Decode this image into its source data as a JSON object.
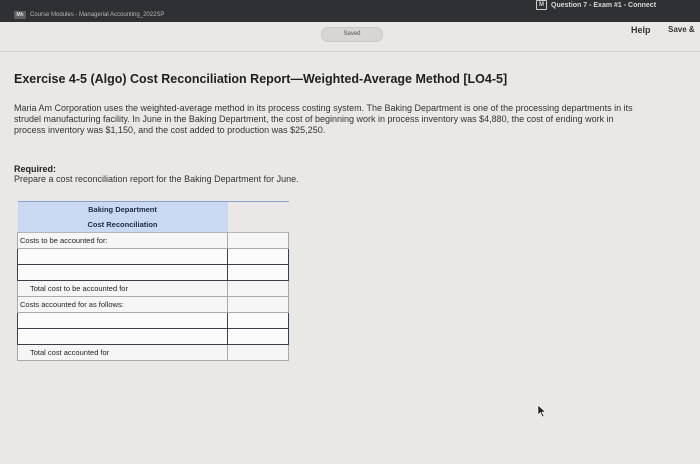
{
  "browser": {
    "left_tab_icon": "Mh",
    "left_tab_title": "Course Modules - Managerial Accounting_2022SP",
    "right_tab_icon": "M",
    "right_tab_title": "Question 7 - Exam #1 - Connect"
  },
  "toolbar": {
    "saved_label": "Saved",
    "help_label": "Help",
    "save_label": "Save &"
  },
  "exercise": {
    "title": "Exercise 4-5 (Algo) Cost Reconciliation Report—Weighted-Average Method [LO4-5]",
    "description": "Maria Am Corporation uses the weighted-average method in its process costing system. The Baking Department is one of the processing departments in its strudel manufacturing facility. In June in the Baking Department, the cost of beginning work in process inventory was $4,880, the cost of ending work in process inventory was $1,150, and the cost added to production was $25,250.",
    "required_label": "Required:",
    "required_text": "Prepare a cost reconciliation report for the Baking Department for June."
  },
  "report": {
    "header_line1": "Baking Department",
    "header_line2": "Cost Reconciliation",
    "costs_to_account_label": "Costs to be accounted for:",
    "total_to_account_label": "Total cost to be accounted for",
    "costs_accounted_label": "Costs accounted for as follows:",
    "total_accounted_label": "Total cost accounted for"
  }
}
